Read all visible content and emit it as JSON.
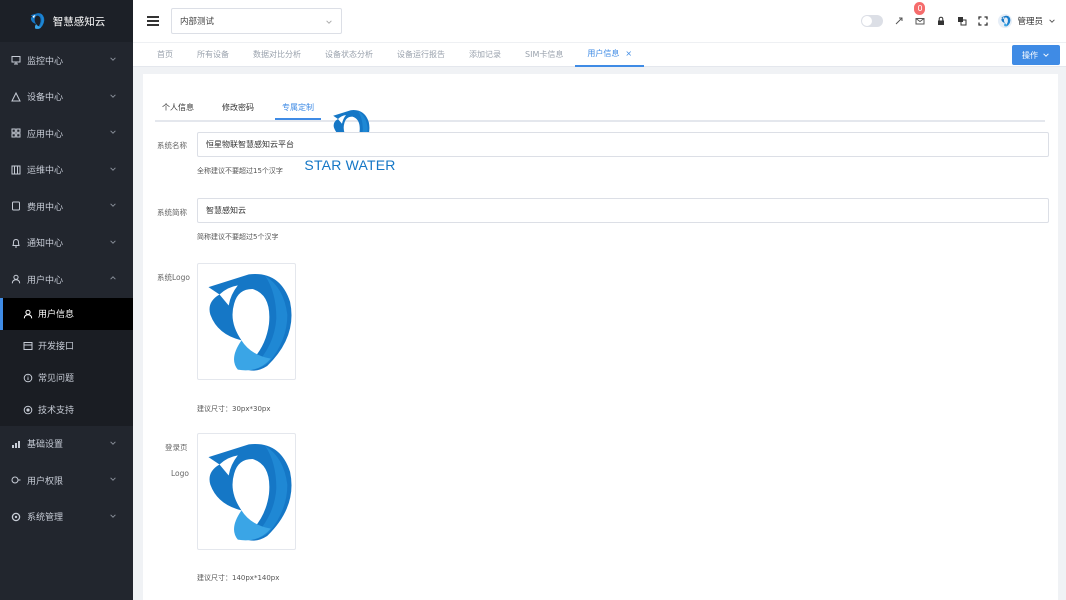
{
  "sidebar": {
    "brand": "智慧感知云",
    "items": [
      {
        "label": "监控中心",
        "icon": "monitor-icon"
      },
      {
        "label": "设备中心",
        "icon": "device-icon"
      },
      {
        "label": "应用中心",
        "icon": "apps-icon"
      },
      {
        "label": "运维中心",
        "icon": "ops-icon"
      },
      {
        "label": "费用中心",
        "icon": "billing-icon"
      },
      {
        "label": "通知中心",
        "icon": "bell-icon"
      },
      {
        "label": "用户中心",
        "icon": "user-icon",
        "expanded": true
      },
      {
        "label": "基础设置",
        "icon": "settings-icon"
      },
      {
        "label": "用户权限",
        "icon": "permission-icon"
      },
      {
        "label": "系统管理",
        "icon": "system-icon"
      }
    ],
    "user_center_sub": [
      {
        "label": "用户信息",
        "icon": "user-icon",
        "active": true
      },
      {
        "label": "开发接口",
        "icon": "api-icon"
      },
      {
        "label": "常见问题",
        "icon": "info-icon"
      },
      {
        "label": "技术支持",
        "icon": "support-icon"
      }
    ]
  },
  "header": {
    "tenant": "内部测试",
    "notification_count": "0",
    "user_name": "管理员"
  },
  "tabs": {
    "items": [
      {
        "label": "首页"
      },
      {
        "label": "所有设备"
      },
      {
        "label": "数据对比分析"
      },
      {
        "label": "设备状态分析"
      },
      {
        "label": "设备运行报告"
      },
      {
        "label": "添加记录"
      },
      {
        "label": "SIM卡信息"
      },
      {
        "label": "用户信息",
        "active": true
      }
    ],
    "close_glyph": "×",
    "ops_label": "操作"
  },
  "profile": {
    "tabs": [
      "个人信息",
      "修改密码",
      "专属定制"
    ],
    "active_tab": 2,
    "system_name_label": "系统名称",
    "system_name_value": "恒星物联智慧感知云平台",
    "system_name_hint": "全称建议不要超过15个汉字",
    "system_short_label": "系统简称",
    "system_short_value": "智慧感知云",
    "system_short_hint": "简称建议不要超过5个汉字",
    "system_logo_label": "系统Logo",
    "system_logo_hint": "建议尺寸：30px*30px",
    "login_logo_label_1": "登录页",
    "login_logo_label_2": "Logo",
    "login_logo_hint": "建议尺寸：140px*140px",
    "brand_text": "STAR WATER"
  },
  "colors": {
    "accent": "#3f8be5",
    "sidebar_bg": "#22262e",
    "logo_dark": "#1577c6",
    "logo_light": "#3aa5e6"
  }
}
